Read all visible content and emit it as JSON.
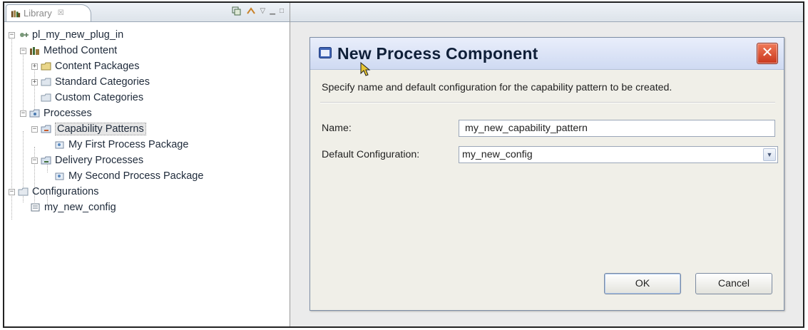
{
  "library_view": {
    "tab_label": "Library",
    "tab_close": "☒",
    "tree": [
      {
        "label": "pl_my_new_plug_in",
        "icon": "plugin-icon"
      },
      {
        "label": "Method Content",
        "icon": "method-content-icon"
      },
      {
        "label": "Content Packages",
        "icon": "content-package-icon"
      },
      {
        "label": "Standard Categories",
        "icon": "standard-categories-icon"
      },
      {
        "label": "Custom Categories",
        "icon": "custom-categories-icon"
      },
      {
        "label": "Processes",
        "icon": "processes-icon"
      },
      {
        "label": "Capability Patterns",
        "icon": "capability-patterns-icon",
        "selected": true
      },
      {
        "label": "My First Process Package",
        "icon": "process-package-icon"
      },
      {
        "label": "Delivery Processes",
        "icon": "delivery-processes-icon"
      },
      {
        "label": "My Second Process Package",
        "icon": "process-package-icon"
      },
      {
        "label": "Configurations",
        "icon": "configurations-icon"
      },
      {
        "label": "my_new_config",
        "icon": "configuration-icon"
      }
    ]
  },
  "dialog": {
    "title": "New Process Component",
    "close_glyph": "✕",
    "description": "Specify name and default configuration for the capability pattern to be created.",
    "name_label": "Name:",
    "name_value": "my_new_capability_pattern",
    "config_label": "Default Configuration:",
    "config_value": "my_new_config",
    "combo_arrow": "▼",
    "ok_label": "OK",
    "cancel_label": "Cancel"
  }
}
